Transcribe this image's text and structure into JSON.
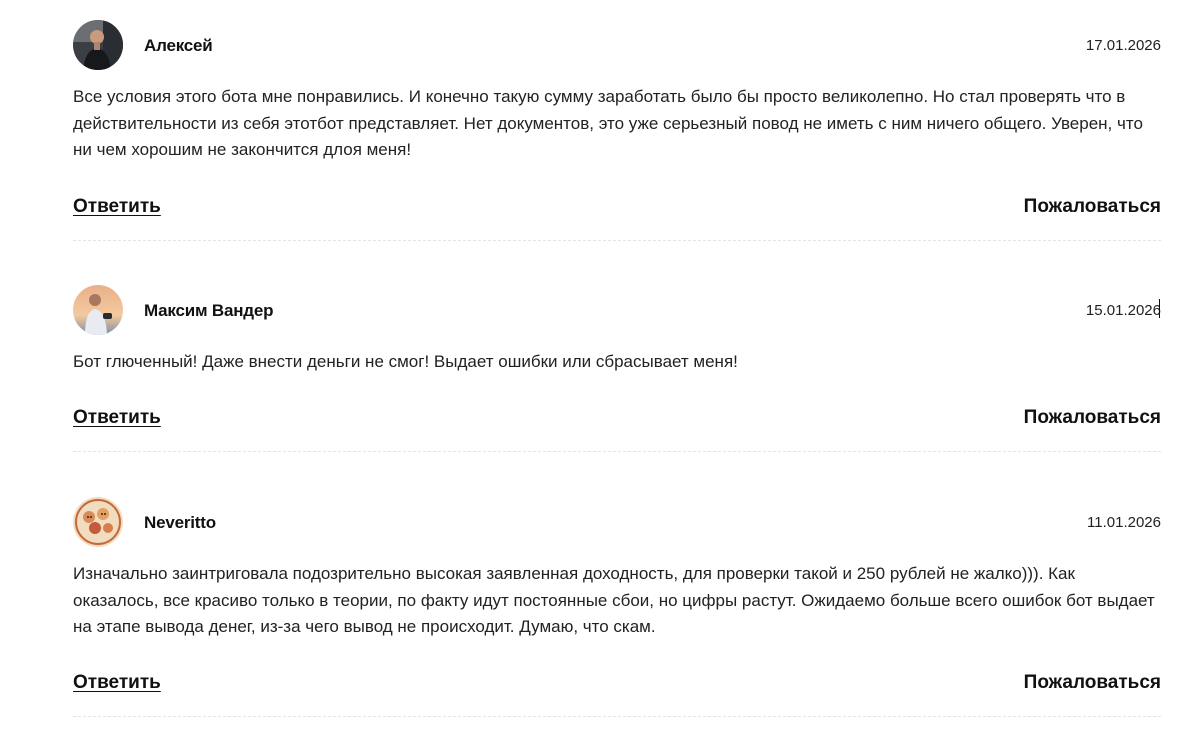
{
  "comments": [
    {
      "author": "Алексей",
      "date": "17.01.2026",
      "text": "Все условия этого бота мне понравились. И конечно такую сумму заработать было бы просто великолепно. Но стал проверять что в действительности из себя этотбот представляет. Нет документов, это уже серьезный повод не иметь с ним ничего общего. Уверен, что ни чем хорошим не закончится длоя меня!",
      "reply_label": "Ответить",
      "complain_label": "Пожаловаться"
    },
    {
      "author": "Максим Вандер",
      "date": "15.01.2026",
      "text": "Бот глюченный! Даже внести деньги не смог! Выдает ошибки или сбрасывает меня!",
      "reply_label": "Ответить",
      "complain_label": "Пожаловаться"
    },
    {
      "author": "Neveritto",
      "date": "11.01.2026",
      "text": "Изначально заинтриговала подозрительно высокая заявленная доходность, для проверки такой и 250 рублей не жалко))). Как оказалось, все красиво только в теории, по факту идут постоянные сбои, но цифры растут. Ожидаемо больше всего ошибок бот выдает на этапе вывода денег, из-за чего вывод не происходит. Думаю, что скам.",
      "reply_label": "Ответить",
      "complain_label": "Пожаловаться"
    }
  ]
}
